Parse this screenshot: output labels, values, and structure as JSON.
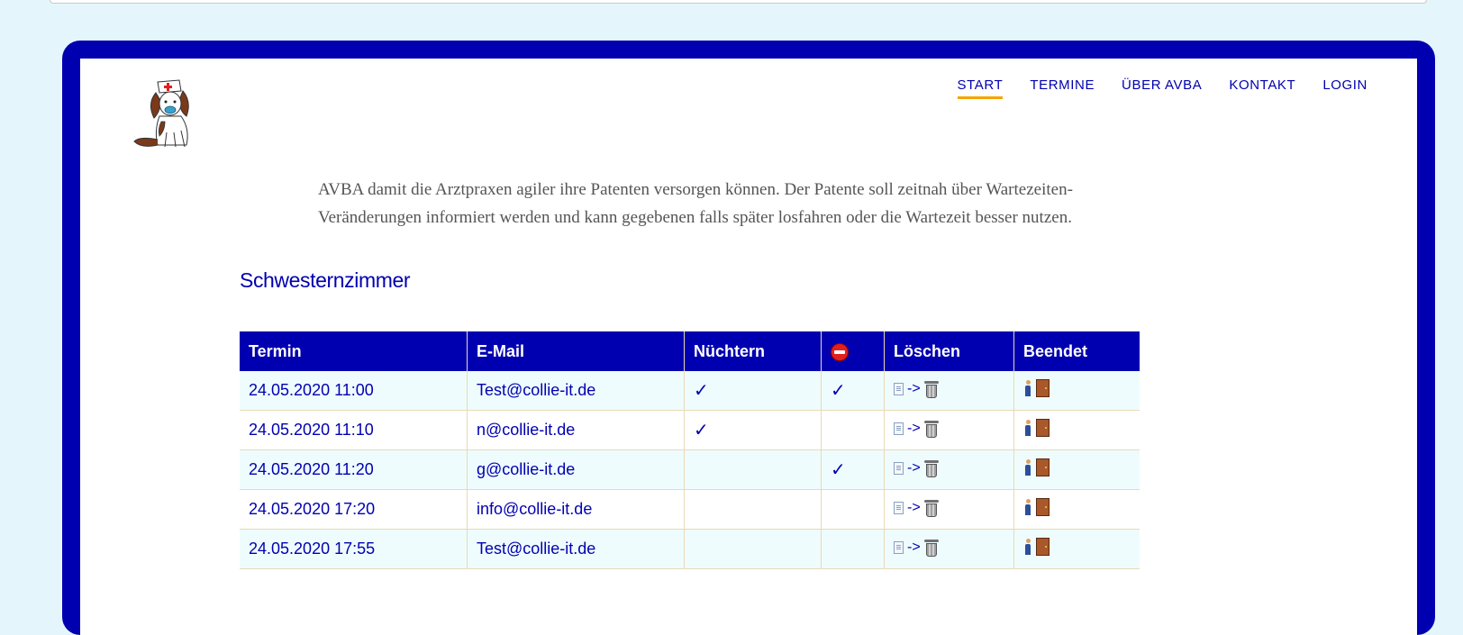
{
  "nav": {
    "items": [
      {
        "label": "START",
        "active": true
      },
      {
        "label": "TERMINE",
        "active": false
      },
      {
        "label": "ÜBER AVBA",
        "active": false
      },
      {
        "label": "KONTAKT",
        "active": false
      },
      {
        "label": "LOGIN",
        "active": false
      }
    ]
  },
  "logo": {
    "icon": "nurse-dog-logo"
  },
  "intro": {
    "text": "AVBA damit die Arztpraxen agiler ihre Patenten versorgen können. Der Patente soll zeitnah über Wartezeiten-Veränderungen informiert werden und kann gegebenen falls später losfahren oder die Wartezeit besser nutzen."
  },
  "section": {
    "title": "Schwesternzimmer"
  },
  "table": {
    "headers": {
      "termin": "Termin",
      "email": "E-Mail",
      "nuechtern": "Nüchtern",
      "stop_icon": "no-entry-icon",
      "loeschen": "Löschen",
      "beendet": "Beendet"
    },
    "delete_arrow": "->",
    "rows": [
      {
        "termin": "24.05.2020 11:00",
        "email": "Test@collie-it.de",
        "nuechtern": "✓",
        "stop": "✓"
      },
      {
        "termin": "24.05.2020 11:10",
        "email": "n@collie-it.de",
        "nuechtern": "✓",
        "stop": ""
      },
      {
        "termin": "24.05.2020 11:20",
        "email": "g@collie-it.de",
        "nuechtern": "",
        "stop": "✓"
      },
      {
        "termin": "24.05.2020 17:20",
        "email": "info@collie-it.de",
        "nuechtern": "",
        "stop": ""
      },
      {
        "termin": "24.05.2020 17:55",
        "email": "Test@collie-it.de",
        "nuechtern": "",
        "stop": ""
      }
    ]
  },
  "colors": {
    "primary": "#0000b0",
    "accent": "#f5a400",
    "page_bg": "#e4f6fb",
    "row_alt": "#effcfe"
  }
}
